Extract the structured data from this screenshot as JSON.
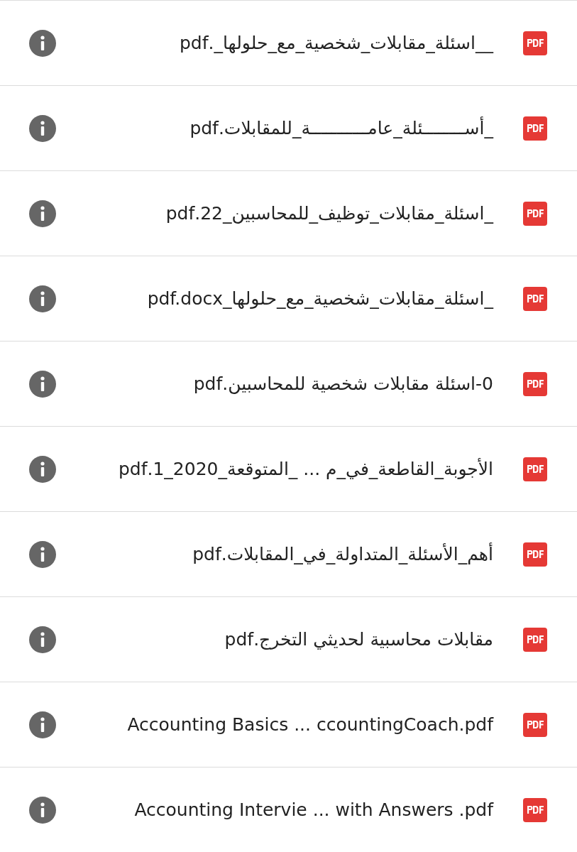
{
  "files": [
    {
      "name": "__اسئلة_مقابلات_شخصية_مع_حلولها_.pdf"
    },
    {
      "name": "_أســــــــئلة_عامـــــــــــة_للمقابلات.pdf"
    },
    {
      "name": "_اسئلة_مقابلات_توظيف_للمحاسبين_22.pdf"
    },
    {
      "name": "_اسئلة_مقابلات_شخصية_مع_حلولها_pdf.docx"
    },
    {
      "name": "0-اسئلة مقابلات شخصية للمحاسبين.pdf"
    },
    {
      "name": "الأجوبة_القاطعة_في_م ... _المتوقعة_2020_1.pdf"
    },
    {
      "name": "أهم_الأسئلة_المتداولة_في_المقابلات.pdf"
    },
    {
      "name": "مقابلات محاسبية لحديثي التخرج.pdf"
    },
    {
      "name": "Accounting Basics ... ccountingCoach.pdf"
    },
    {
      "name": "Accounting Intervie ... with Answers .pdf"
    }
  ]
}
